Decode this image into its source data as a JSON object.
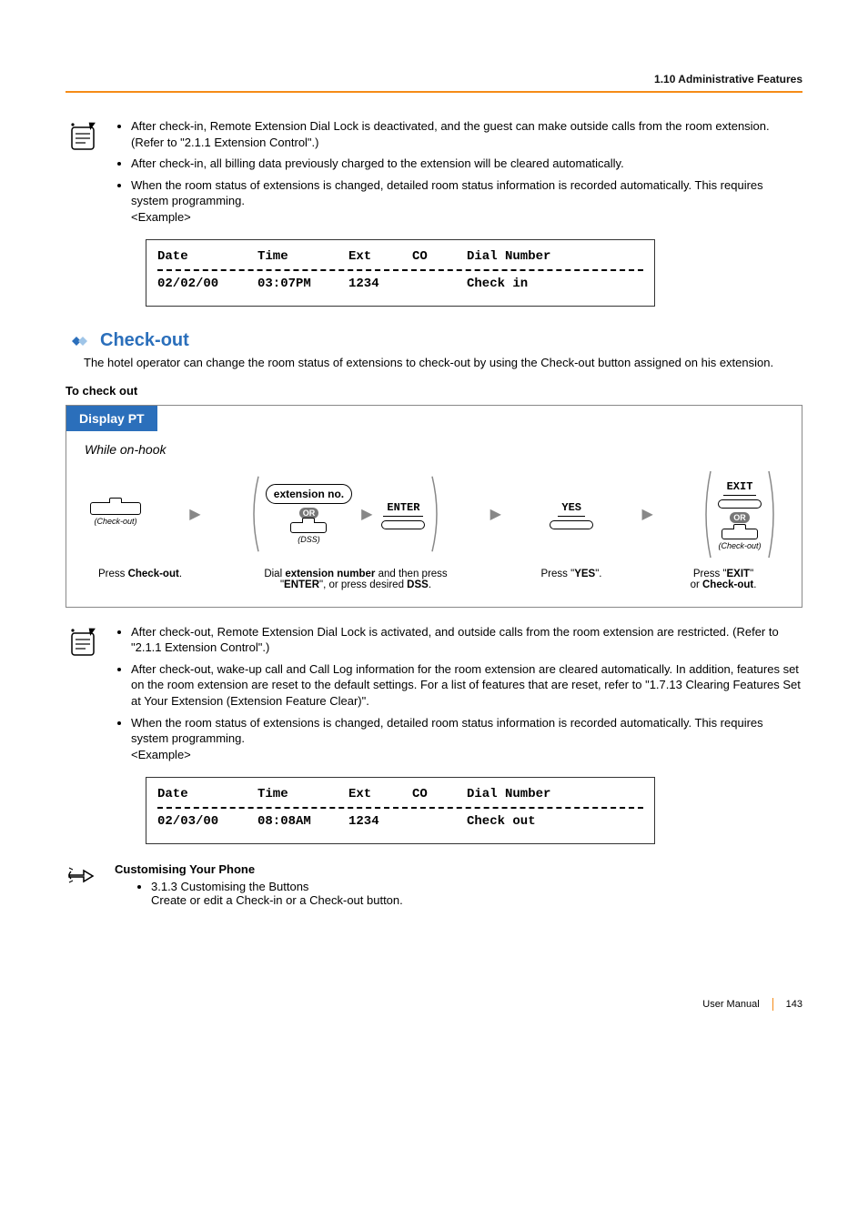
{
  "header": {
    "section_label": "1.10 Administrative Features"
  },
  "notes1": {
    "items": [
      "After check-in, Remote Extension Dial Lock is deactivated, and the guest can make outside calls from the room extension. (Refer to \"2.1.1 Extension Control\".)",
      "After check-in, all billing data previously charged to the extension will be cleared automatically.",
      "When the room status of extensions is changed, detailed room status information is recorded automatically. This requires system programming.\n<Example>"
    ]
  },
  "example1": {
    "cols": {
      "date": "Date",
      "time": "Time",
      "ext": "Ext",
      "co": "CO",
      "dial": "Dial Number"
    },
    "row": {
      "date": "02/02/00",
      "time": "03:07PM",
      "ext": "1234",
      "co": "",
      "dial": "Check in"
    }
  },
  "section": {
    "title": "Check-out",
    "intro": "The hotel operator can change the room status of extensions to check-out by using the Check-out button assigned on his extension."
  },
  "procedure": {
    "heading": "To check out",
    "box_title": "Display PT",
    "subtitle": "While on-hook",
    "step1": {
      "button_label": "(Check-out)",
      "caption_prefix": "Press ",
      "caption_bold": "Check-out",
      "caption_suffix": "."
    },
    "step2": {
      "roundbox": "extension no.",
      "enter_key": "ENTER",
      "or": "OR",
      "dss_label": "(DSS)",
      "caption": {
        "p1": "Dial ",
        "b1": "extension number",
        "p2": " and then press ",
        "p3": "\"",
        "b2": "ENTER",
        "p4": "\",",
        "p5": " or press desired ",
        "b3": "DSS",
        "p6": "."
      }
    },
    "step3": {
      "yes_key": "YES",
      "caption_prefix": "Press \"",
      "caption_bold": "YES",
      "caption_suffix": "\"."
    },
    "step4": {
      "exit_key": "EXIT",
      "or": "OR",
      "button_label": "(Check-out)",
      "caption": {
        "p1": "Press \"",
        "b1": "EXIT",
        "p2": "\"",
        "p3": " or ",
        "b2": "Check-out",
        "p4": "."
      }
    }
  },
  "notes2": {
    "items": [
      "After check-out, Remote Extension Dial Lock is activated, and outside calls from the room extension are restricted. (Refer to \"2.1.1 Extension Control\".)",
      "After check-out, wake-up call and Call Log information for the room extension are cleared automatically. In addition, features set on the room extension are reset to the default settings. For a list of features that are reset, refer to \"1.7.13 Clearing Features Set at Your Extension (Extension Feature Clear)\".",
      "When the room status of extensions is changed, detailed room status information is recorded automatically. This requires system programming.\n<Example>"
    ]
  },
  "example2": {
    "cols": {
      "date": "Date",
      "time": "Time",
      "ext": "Ext",
      "co": "CO",
      "dial": "Dial Number"
    },
    "row": {
      "date": "02/03/00",
      "time": "08:08AM",
      "ext": "1234",
      "co": "",
      "dial": "Check out"
    }
  },
  "customising": {
    "title": "Customising Your Phone",
    "bullet_title": "3.1.3 Customising the Buttons",
    "bullet_body": "Create or edit a Check-in or a Check-out button."
  },
  "footer": {
    "manual": "User Manual",
    "page": "143"
  }
}
